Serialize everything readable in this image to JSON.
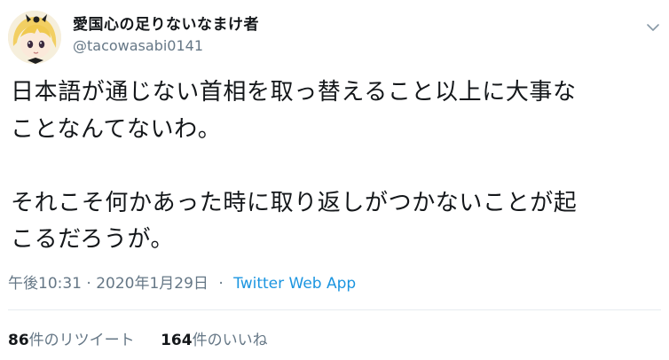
{
  "tweet": {
    "display_name": "愛国心の足りないなまけ者",
    "handle": "@tacowasabi0141",
    "paragraph1_line1": "日本語が通じない首相を取っ替えること以上に大事な",
    "paragraph1_line2": "ことなんてないわ。",
    "paragraph2_line1": "それこそ何かあった時に取り返しがつかないことが起",
    "paragraph2_line2": "こるだろうが。",
    "timestamp": "午後10:31 · 2020年1月29日",
    "separator": "·",
    "source_app": "Twitter Web App"
  },
  "stats": {
    "retweets_count": "86",
    "retweets_label": "件のリツイート",
    "likes_count": "164",
    "likes_label": "件のいいね"
  },
  "icons": {
    "avatar": "anime-girl-avatar",
    "menu": "chevron-down-icon"
  },
  "colors": {
    "text": "#14171a",
    "muted": "#657786",
    "link": "#1b95e0",
    "divider": "#e6ecf0"
  }
}
